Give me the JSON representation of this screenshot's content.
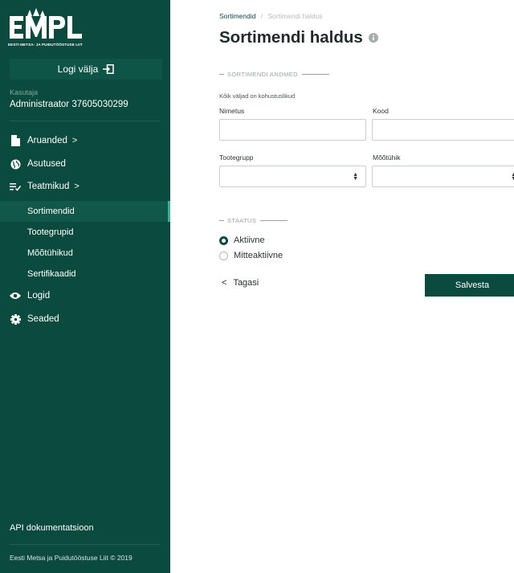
{
  "brand": {
    "logo_text": "EMPL",
    "logo_subtitle": "EESTI METSA- JA PUIDUTÖÖSTUSE LIIT"
  },
  "sidebar": {
    "logout_label": "Logi välja",
    "user_label": "Kasutaja",
    "user_name": "Administraator 37605030299",
    "items": [
      {
        "label": "Aruanded",
        "icon": "file-icon",
        "has_chevron": true
      },
      {
        "label": "Asutused",
        "icon": "globe-icon",
        "has_chevron": false
      },
      {
        "label": "Teatmikud",
        "icon": "list-check-icon",
        "has_chevron": true
      },
      {
        "label": "Logid",
        "icon": "eye-icon",
        "has_chevron": false
      },
      {
        "label": "Seaded",
        "icon": "gear-icon",
        "has_chevron": false
      }
    ],
    "sub_items": [
      {
        "label": "Sortimendid",
        "active": true
      },
      {
        "label": "Tootegrupid",
        "active": false
      },
      {
        "label": "Mõõtühikud",
        "active": false
      },
      {
        "label": "Sertifikaadid",
        "active": false
      }
    ],
    "chevron": ">",
    "api_link": "API dokumentatsioon",
    "footer": "Eesti Metsa ja Puidutööstuse Liit © 2019"
  },
  "breadcrumb": {
    "parent": "Sortimendid",
    "separator": "/",
    "current": "Sortimendi haldus"
  },
  "page": {
    "title": "Sortimendi haldus"
  },
  "form": {
    "section_details": "SORTIMENDI ANDMED",
    "required_note": "Kõik väljad on kohustuslikud",
    "name_label": "Nimetus",
    "name_value": "",
    "code_label": "Kood",
    "code_value": "",
    "group_label": "Tootegrupp",
    "group_value": "",
    "unit_label": "Mõõtühik",
    "unit_value": "",
    "section_status": "STAATUS",
    "status_options": [
      {
        "label": "Aktiivne",
        "selected": true
      },
      {
        "label": "Mitteaktiivne",
        "selected": false
      }
    ],
    "back_label": "Tagasi",
    "back_chevron": "<",
    "save_label": "Salvesta"
  },
  "colors": {
    "sidebar_bg": "#0b4a3f",
    "accent": "#0b4a3f",
    "active_indicator": "#3fb08f"
  }
}
